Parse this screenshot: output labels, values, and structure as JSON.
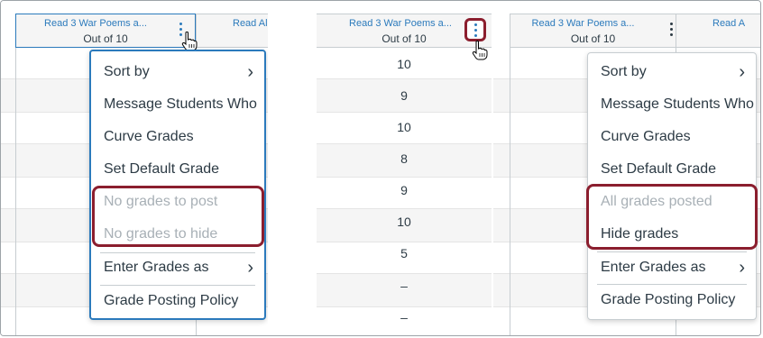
{
  "column": {
    "title": "Read 3 War Poems a...",
    "out_of": "Out of 10",
    "next_title_a": "Read Al",
    "next_title_b": "Read A"
  },
  "grades": [
    "10",
    "9",
    "10",
    "8",
    "9",
    "10",
    "5",
    "–",
    "–"
  ],
  "menu_left": {
    "items": [
      {
        "label": "Sort by",
        "submenu": true
      },
      {
        "label": "Message Students Who"
      },
      {
        "label": "Curve Grades"
      },
      {
        "label": "Set Default Grade"
      },
      {
        "label": "No grades to post",
        "disabled": true
      },
      {
        "label": "No grades to hide",
        "disabled": true
      },
      {
        "label": "Enter Grades as",
        "submenu": true
      },
      {
        "label": "Grade Posting Policy"
      }
    ]
  },
  "menu_right": {
    "items": [
      {
        "label": "Sort by",
        "submenu": true
      },
      {
        "label": "Message Students Who"
      },
      {
        "label": "Curve Grades"
      },
      {
        "label": "Set Default Grade"
      },
      {
        "label": "All grades posted",
        "disabled": true
      },
      {
        "label": "Hide grades"
      },
      {
        "label": "Enter Grades as",
        "submenu": true
      },
      {
        "label": "Grade Posting Policy"
      }
    ]
  },
  "icons": {
    "chevron": "›",
    "kebab": "kebab-menu-icon",
    "cursor": "hand-pointer-cursor"
  },
  "colors": {
    "link_blue": "#2b7abc",
    "highlight_red": "#8b1e2e",
    "disabled_gray": "#a8b0b6"
  }
}
